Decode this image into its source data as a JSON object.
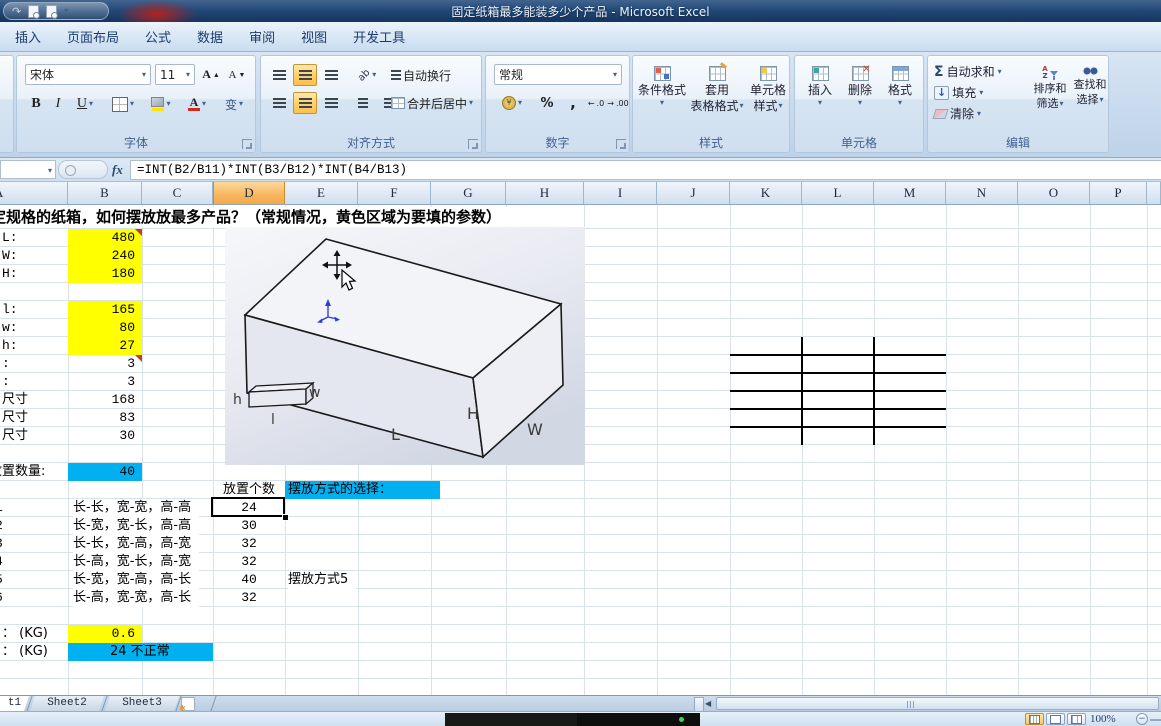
{
  "window": {
    "title": "固定纸箱最多能装多少个产品 - Microsoft Excel"
  },
  "ribbon_tabs": [
    "插入",
    "页面布局",
    "公式",
    "数据",
    "审阅",
    "视图",
    "开发工具"
  ],
  "ribbon": {
    "font_group": {
      "label": "字体",
      "font_name": "宋体",
      "font_size": "11",
      "grow": "A",
      "shrink": "A",
      "bold": "B",
      "italic": "I",
      "underline": "U",
      "pinyin": "变"
    },
    "align_group": {
      "label": "对齐方式",
      "wrap": "自动换行",
      "merge": "合并后居中"
    },
    "number_group": {
      "label": "数字",
      "format": "常规",
      "currency": "¥",
      "percent": "%",
      "comma": ",",
      "incdec": ".0",
      "decdec": ".00"
    },
    "styles_group": {
      "label": "样式",
      "conditional": "条件格式",
      "table1": "套用",
      "table2": "表格格式",
      "cellstyle1": "单元格",
      "cellstyle2": "样式"
    },
    "cells_group": {
      "label": "单元格",
      "insert": "插入",
      "del": "删除",
      "format": "格式"
    },
    "edit_group": {
      "label": "编辑",
      "sigma": "Σ",
      "autosum": "自动求和",
      "fill": "填充",
      "clear": "清除",
      "sort1": "排序和",
      "sort2": "筛选",
      "find1": "查找和",
      "find2": "选择"
    }
  },
  "formula_bar": {
    "fx": "fx",
    "formula": "=INT(B2/B11)*INT(B3/B12)*INT(B4/B13)"
  },
  "columns": [
    "A",
    "B",
    "C",
    "D",
    "E",
    "F",
    "G",
    "H",
    "I",
    "J",
    "K",
    "L",
    "M",
    "N",
    "O",
    "P"
  ],
  "cells": {
    "a1": "定规格的纸箱，如何摆放放最多产品？（常规情况，黄色区域为要填的参数）",
    "a2": "L:",
    "b2": "480",
    "a3": "W:",
    "b3": "240",
    "a4": "H:",
    "b4": "180",
    "a6": "l:",
    "b6": "165",
    "a7": "w:",
    "b7": "80",
    "a8": "h:",
    "b8": "27",
    "a9": ":",
    "b9": "3",
    "a10": ":",
    "b10": "3",
    "a11": "尺寸",
    "b11": "168",
    "a12": "尺寸",
    "b12": "83",
    "a13": "尺寸",
    "b13": "30",
    "a15": "放置数量:",
    "b15": "40",
    "d16": "放置个数",
    "e16": "摆放方式的选择：",
    "a17": "1",
    "b17": "长-长，宽-宽，高-高",
    "d17": "24",
    "a18": "2",
    "b18": "长-宽，宽-长，高-高",
    "d18": "30",
    "a19": "3",
    "b19": "长-长，宽-高，高-宽",
    "d19": "32",
    "a20": "4",
    "b20": "长-高，宽-长，高-宽",
    "d20": "32",
    "a21": "5",
    "b21": "长-宽，宽-高，高-长",
    "d21": "40",
    "e21": "摆放方式5",
    "a22": "6",
    "b22": "长-高，宽-宽，高-长",
    "d22": "32",
    "a24": "： (KG)",
    "b24": "0.6",
    "a25": "： (KG)",
    "b25": "24 不正常"
  },
  "image_labels": {
    "h": "h",
    "w": "w",
    "l": "l",
    "bigL": "L",
    "bigH": "H",
    "bigW": "W"
  },
  "sheet_tabs": {
    "active": "t1",
    "s2": "Sheet2",
    "s3": "Sheet3"
  },
  "status": {
    "zoom": "100%"
  }
}
